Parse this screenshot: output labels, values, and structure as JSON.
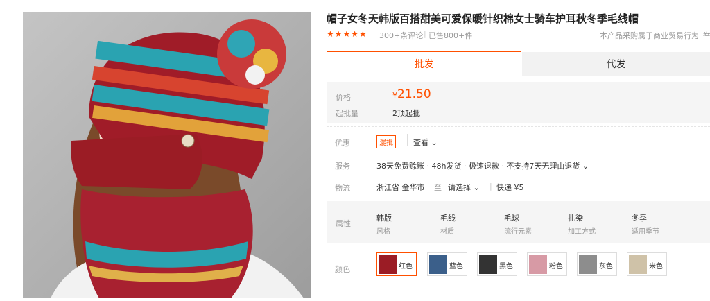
{
  "product": {
    "title": "帽子女冬天韩版百搭甜美可爱保暖针织棉女士骑车护耳秋冬季毛线帽",
    "stars": "★★★★★",
    "reviews": "300+条评论",
    "sold": "已售800+件",
    "notice": "本产品采购属于商业贸易行为",
    "notice_extra": "举"
  },
  "tabs": [
    "批发",
    "代发"
  ],
  "price": {
    "label": "价格",
    "currency": "¥",
    "value": "21.50",
    "moq_label": "起批量",
    "moq_value": "2顶起批"
  },
  "promo": {
    "label": "优惠",
    "tag": "混批",
    "view": "查看 ⌄"
  },
  "service": {
    "label": "服务",
    "text": "38天免费赊账 · 48h发货 · 极速退款 · 不支持7天无理由退货 ⌄"
  },
  "logistics": {
    "label": "物流",
    "from": "浙江省 金华市",
    "to_word": "至",
    "select": "请选择 ⌄",
    "express": "快递 ¥5"
  },
  "attributes": {
    "label": "属性",
    "items": [
      {
        "value": "韩版",
        "name": "风格"
      },
      {
        "value": "毛线",
        "name": "材质"
      },
      {
        "value": "毛球",
        "name": "流行元素"
      },
      {
        "value": "扎染",
        "name": "加工方式"
      },
      {
        "value": "冬季",
        "name": "适用季节"
      }
    ]
  },
  "colors": {
    "label": "颜色",
    "items": [
      {
        "name": "红色",
        "swatch": "#9b1c25"
      },
      {
        "name": "蓝色",
        "swatch": "#3b5f8a"
      },
      {
        "name": "黑色",
        "swatch": "#333333"
      },
      {
        "name": "粉色",
        "swatch": "#d79aa5"
      },
      {
        "name": "灰色",
        "swatch": "#8d8d8d"
      },
      {
        "name": "米色",
        "swatch": "#cfc2a8"
      }
    ]
  },
  "accent_color": "#ff5000"
}
